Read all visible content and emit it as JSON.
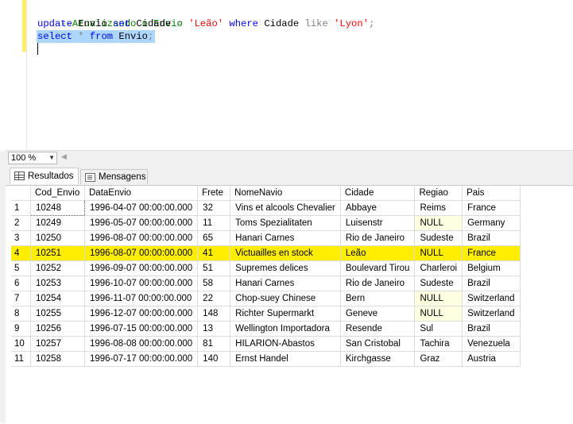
{
  "editor": {
    "line1": "--Atualizando o Envio",
    "line2": {
      "kw_update": "update",
      "tbl": " Envio ",
      "kw_set": "set",
      "col": " Cidade ",
      "eq": "=",
      "val": "'Leão'",
      "kw_where": " where ",
      "col2": "Cidade ",
      "kw_like": "like",
      "val2": "'Lyon'",
      "semi": ";"
    },
    "line3": {
      "kw_select": "select",
      "star": " * ",
      "kw_from": "from",
      "tbl": " Envio",
      "semi": ";"
    }
  },
  "zoom": {
    "value": "100 %"
  },
  "tabs": {
    "results": "Resultados",
    "messages": "Mensagens"
  },
  "grid": {
    "columns": [
      "Cod_Envio",
      "DataEnvio",
      "Frete",
      "NomeNavio",
      "Cidade",
      "Regiao",
      "Pais"
    ],
    "rows": [
      [
        "1",
        "10248",
        "1996-04-07 00:00:00.000",
        "32",
        "Vins et alcools Chevalier",
        "Abbaye",
        "Reims",
        "France"
      ],
      [
        "2",
        "10249",
        "1996-05-07 00:00:00.000",
        "11",
        "Toms Spezialitaten",
        "Luisenstr",
        "NULL",
        "Germany"
      ],
      [
        "3",
        "10250",
        "1996-08-07 00:00:00.000",
        "65",
        "Hanari Carnes",
        "Rio de Janeiro",
        "Sudeste",
        "Brazil"
      ],
      [
        "4",
        "10251",
        "1996-08-07 00:00:00.000",
        "41",
        "Victuailles en stock",
        "Leão",
        "NULL",
        "France"
      ],
      [
        "5",
        "10252",
        "1996-09-07 00:00:00.000",
        "51",
        "Supremes delices",
        "Boulevard Tirou",
        "Charleroi",
        "Belgium"
      ],
      [
        "6",
        "10253",
        "1996-10-07 00:00:00.000",
        "58",
        "Hanari Carnes",
        "Rio de Janeiro",
        "Sudeste",
        "Brazil"
      ],
      [
        "7",
        "10254",
        "1996-11-07 00:00:00.000",
        "22",
        "Chop-suey Chinese",
        "Bern",
        "NULL",
        "Switzerland"
      ],
      [
        "8",
        "10255",
        "1996-12-07 00:00:00.000",
        "148",
        "Richter Supermarkt",
        "Geneve",
        "NULL",
        "Switzerland"
      ],
      [
        "9",
        "10256",
        "1996-07-15 00:00:00.000",
        "13",
        "Wellington Importadora",
        "Resende",
        "Sul",
        "Brazil"
      ],
      [
        "10",
        "10257",
        "1996-08-08 00:00:00.000",
        "81",
        "HILARION-Abastos",
        "San Cristobal",
        "Tachira",
        "Venezuela"
      ],
      [
        "11",
        "10258",
        "1996-07-17 00:00:00.000",
        "140",
        "Ernst Handel",
        "Kirchgasse",
        "Graz",
        "Austria"
      ]
    ],
    "selected_row": 4
  },
  "colors": {
    "keyword": "#0000ff",
    "string": "#ff0000",
    "comment": "#008000",
    "selected_row": "#ffee00",
    "null_cell": "#ffffe1"
  }
}
